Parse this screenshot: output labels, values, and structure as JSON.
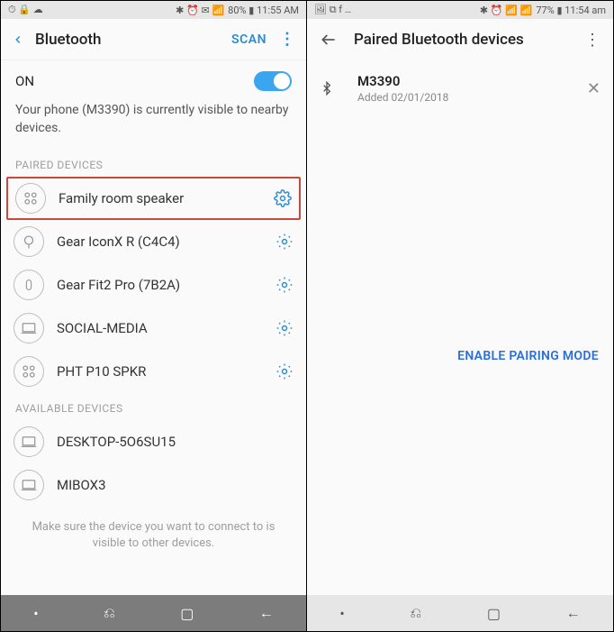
{
  "left": {
    "statusbar": {
      "left_icons": "⏱ 🔒 ☁",
      "right_text": "80% ▮ 11:55 AM",
      "right_icons": "✱ ⏰ ✉ 📶"
    },
    "header": {
      "title": "Bluetooth",
      "scan": "SCAN"
    },
    "on_label": "ON",
    "visibility_text": "Your phone (M3390) is currently visible to nearby devices.",
    "paired_label": "PAIRED DEVICES",
    "paired": [
      {
        "name": "Family room speaker",
        "icon": "speaker",
        "highlight": true
      },
      {
        "name": "Gear IconX R (C4C4)",
        "icon": "earbud"
      },
      {
        "name": "Gear Fit2 Pro (7B2A)",
        "icon": "watch"
      },
      {
        "name": "SOCIAL-MEDIA",
        "icon": "laptop"
      },
      {
        "name": "PHT P10 SPKR",
        "icon": "speaker"
      }
    ],
    "available_label": "AVAILABLE DEVICES",
    "available": [
      {
        "name": "DESKTOP-5O6SU15",
        "icon": "laptop"
      },
      {
        "name": "MIBOX3",
        "icon": "laptop"
      }
    ],
    "hint": "Make sure the device you want to connect to is visible to other devices."
  },
  "right": {
    "statusbar": {
      "left_icons": "🖼 ⧉ f …",
      "right_text": "77% ▮ 11:54 am",
      "right_icons": "✱ ⏰ 📶 📶"
    },
    "header": {
      "title": "Paired Bluetooth devices"
    },
    "device": {
      "name": "M3390",
      "sub": "Added 02/01/2018"
    },
    "enable": "ENABLE PAIRING MODE"
  }
}
